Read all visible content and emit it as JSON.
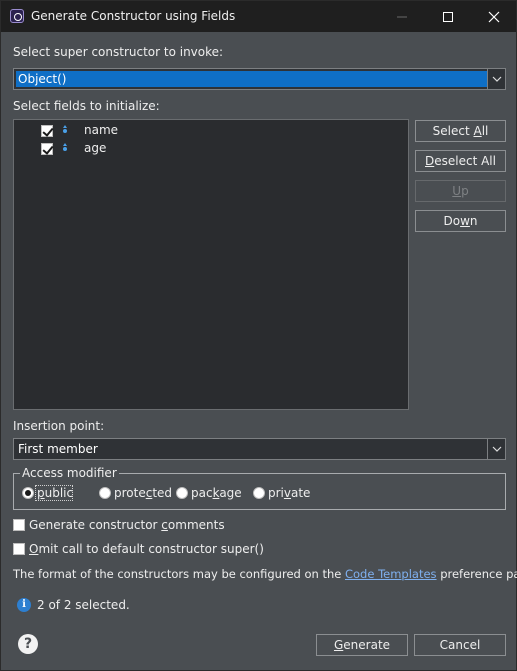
{
  "window": {
    "title": "Generate Constructor using Fields",
    "minimize_icon": "minimize-icon",
    "maximize_icon": "maximize-icon",
    "close_icon": "close-icon"
  },
  "super_constructor": {
    "label": "Select super constructor to invoke:",
    "selected": "Object()"
  },
  "fields": {
    "label": "Select fields to initialize:",
    "items": [
      {
        "name": "name",
        "checked": true
      },
      {
        "name": "age",
        "checked": true
      }
    ]
  },
  "side_buttons": {
    "select_all": {
      "pre": "Select ",
      "mnemonic": "A",
      "post": "ll"
    },
    "deselect_all": {
      "pre": "",
      "mnemonic": "D",
      "post": "eselect All"
    },
    "up": {
      "pre": "",
      "mnemonic": "U",
      "post": "p"
    },
    "down": {
      "pre": "Do",
      "mnemonic": "w",
      "post": "n"
    }
  },
  "insertion": {
    "label": "Insertion point:",
    "selected": "First member"
  },
  "access_modifier": {
    "title": "Access modifier",
    "options": [
      {
        "pre": "",
        "mnemonic": "p",
        "post": "ublic",
        "selected": true
      },
      {
        "pre": "prote",
        "mnemonic": "c",
        "post": "ted",
        "selected": false
      },
      {
        "pre": "pac",
        "mnemonic": "k",
        "post": "age",
        "selected": false
      },
      {
        "pre": "pri",
        "mnemonic": "v",
        "post": "ate",
        "selected": false
      }
    ]
  },
  "options": {
    "comments": {
      "pre": "Generate constructor ",
      "mnemonic": "c",
      "post": "omments",
      "checked": false
    },
    "omit_super": {
      "pre": "",
      "mnemonic": "O",
      "post": "mit call to default constructor super()",
      "checked": false
    }
  },
  "templates_note": {
    "pre": "The format of the constructors may be configured on the ",
    "link": "Code Templates",
    "post": " preference page."
  },
  "status": "2 of 2 selected.",
  "footer": {
    "generate": {
      "pre": "",
      "mnemonic": "G",
      "post": "enerate"
    },
    "cancel": "Cancel"
  },
  "colors": {
    "dialog_bg": "#4a4e52",
    "titlebar_bg": "#1f1f1f",
    "list_bg": "#2a2c2f",
    "selection": "#0f6fc6",
    "link": "#7fb0ef"
  }
}
